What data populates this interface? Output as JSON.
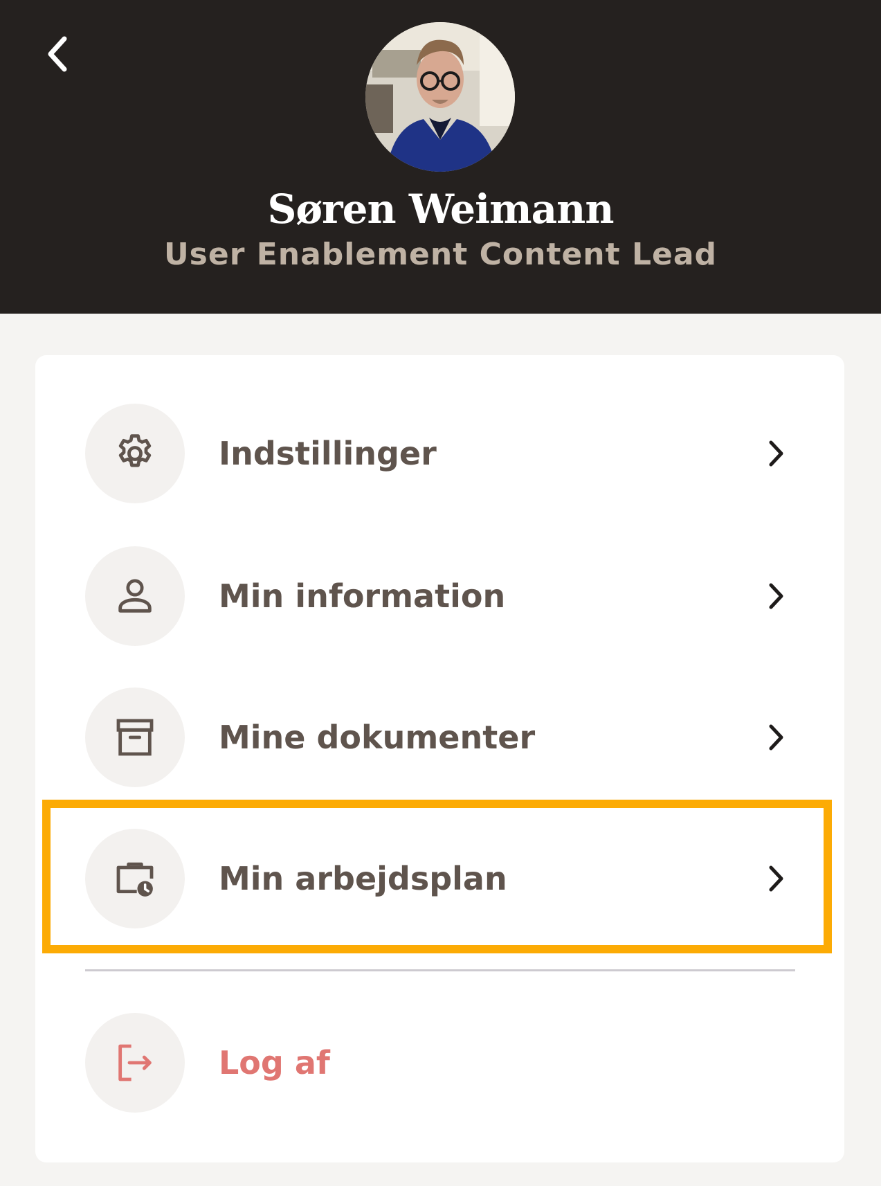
{
  "header": {
    "back_icon": "chevron-left-icon",
    "user_name": "Søren Weimann",
    "user_title": "User Enablement Content Lead"
  },
  "menu": {
    "items": [
      {
        "label": "Indstillinger",
        "icon": "gear-icon"
      },
      {
        "label": "Min information",
        "icon": "person-icon"
      },
      {
        "label": "Mine dokumenter",
        "icon": "archive-box-icon"
      },
      {
        "label": "Min arbejdsplan",
        "icon": "briefcase-clock-icon",
        "highlighted": true
      }
    ],
    "logout": {
      "label": "Log af",
      "icon": "logout-icon"
    }
  },
  "colors": {
    "header_bg": "#25211f",
    "page_bg": "#f5f4f2",
    "text_primary": "#5f544d",
    "subtitle": "#bfb2a4",
    "danger": "#e07672",
    "highlight": "#fcab05"
  }
}
